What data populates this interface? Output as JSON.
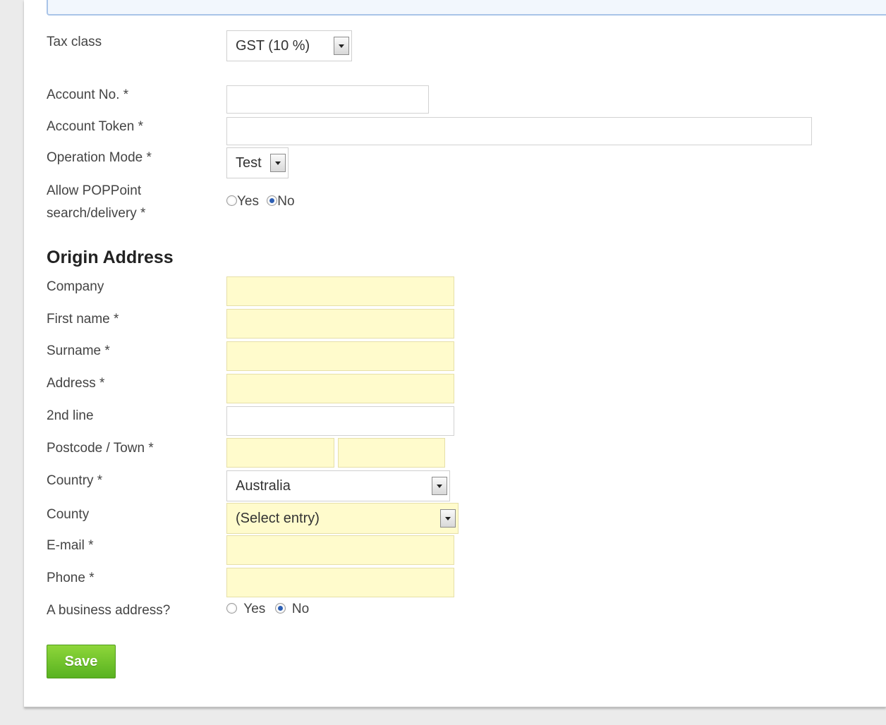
{
  "tax_class": {
    "label": "Tax class",
    "value": "GST (10 %)"
  },
  "account_no": {
    "label": "Account No. *",
    "value": ""
  },
  "account_token": {
    "label": "Account Token *",
    "value": ""
  },
  "operation_mode": {
    "label": "Operation Mode *",
    "value": "Test"
  },
  "allow_poppoint": {
    "label_line1": "Allow POPPoint",
    "label_line2": "search/delivery *",
    "yes": "Yes",
    "no": "No",
    "selected": "No"
  },
  "origin_address": {
    "title": "Origin Address",
    "company": {
      "label": "Company",
      "value": ""
    },
    "first_name": {
      "label": "First name *",
      "value": ""
    },
    "surname": {
      "label": "Surname *",
      "value": ""
    },
    "address": {
      "label": "Address *",
      "value": ""
    },
    "second_line": {
      "label": "2nd line",
      "value": ""
    },
    "postcode_town": {
      "label": "Postcode / Town *",
      "postcode": "",
      "town": ""
    },
    "country": {
      "label": "Country *",
      "value": "Australia"
    },
    "county": {
      "label": "County",
      "value": "(Select entry)"
    },
    "email": {
      "label": "E-mail *",
      "value": ""
    },
    "phone": {
      "label": "Phone *",
      "value": ""
    },
    "business_address": {
      "label": "A business address?",
      "yes": "Yes",
      "no": "No",
      "selected": "No"
    }
  },
  "save_label": "Save",
  "colors": {
    "required_field_bg": "#fffbcc",
    "save_button": "#6cc128",
    "top_box_border": "#a9c4e8"
  }
}
